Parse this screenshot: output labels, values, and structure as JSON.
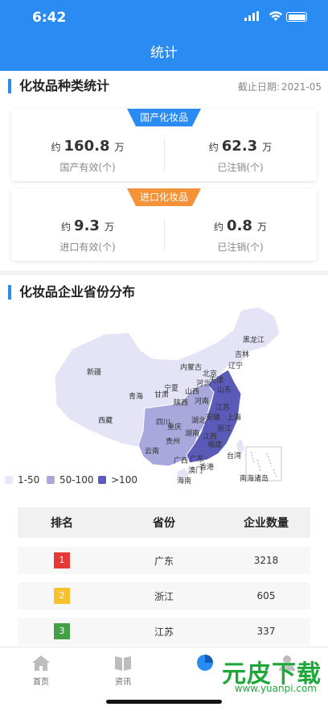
{
  "status_bar": {
    "time": "6:42"
  },
  "navbar": {
    "title": "统计"
  },
  "types_section": {
    "title": "化妆品种类统计",
    "deadline_label": "截止日期:",
    "deadline_value": "2021-05"
  },
  "domestic_card": {
    "tag": "国产化妆品",
    "left": {
      "prefix": "约",
      "value": "160.8",
      "unit": "万",
      "label": "国产有效(个)"
    },
    "right": {
      "prefix": "约",
      "value": "62.3",
      "unit": "万",
      "label": "已注销(个)"
    }
  },
  "imported_card": {
    "tag": "进口化妆品",
    "left": {
      "prefix": "约",
      "value": "9.3",
      "unit": "万",
      "label": "进口有效(个)"
    },
    "right": {
      "prefix": "约",
      "value": "0.8",
      "unit": "万",
      "label": "已注销(个)"
    }
  },
  "map_section": {
    "title": "化妆品企业省份分布",
    "labels": [
      "新疆",
      "西藏",
      "青海",
      "甘肃",
      "宁夏",
      "内蒙古",
      "黑龙江",
      "吉林",
      "辽宁",
      "北京",
      "天津",
      "河北",
      "山西",
      "陕西",
      "山东",
      "河南",
      "江苏",
      "上海",
      "安徽",
      "湖北",
      "四川",
      "重庆",
      "浙江",
      "湖南",
      "江西",
      "贵州",
      "云南",
      "福建",
      "广西",
      "广东",
      "台湾",
      "香港",
      "澳门",
      "海南",
      "南海诸岛"
    ],
    "legend": [
      {
        "label": "1-50",
        "color": "#e8e8f7"
      },
      {
        "label": "50-100",
        "color": "#a8a8dc"
      },
      {
        "label": ">100",
        "color": "#5a5ab8"
      }
    ]
  },
  "ranking_table": {
    "headers": [
      "排名",
      "省份",
      "企业数量"
    ],
    "rows": [
      {
        "rank": "1",
        "province": "广东",
        "count": "3218",
        "color": "#e53935"
      },
      {
        "rank": "2",
        "province": "浙江",
        "count": "605",
        "color": "#fbc02d"
      },
      {
        "rank": "3",
        "province": "江苏",
        "count": "337",
        "color": "#43a047"
      }
    ]
  },
  "tabbar": {
    "items": [
      {
        "label": "首页",
        "icon": "home-icon"
      },
      {
        "label": "资讯",
        "icon": "book-icon"
      },
      {
        "label": "",
        "icon": "stats-icon"
      },
      {
        "label": "",
        "icon": "user-icon"
      }
    ]
  },
  "watermark": {
    "text": "元皮下载",
    "url": "www.yuanpi.com"
  },
  "colors": {
    "brand": "#2a8bf2",
    "domestic_tag": "#2a8bf2",
    "imported_tag": "#f39237"
  }
}
